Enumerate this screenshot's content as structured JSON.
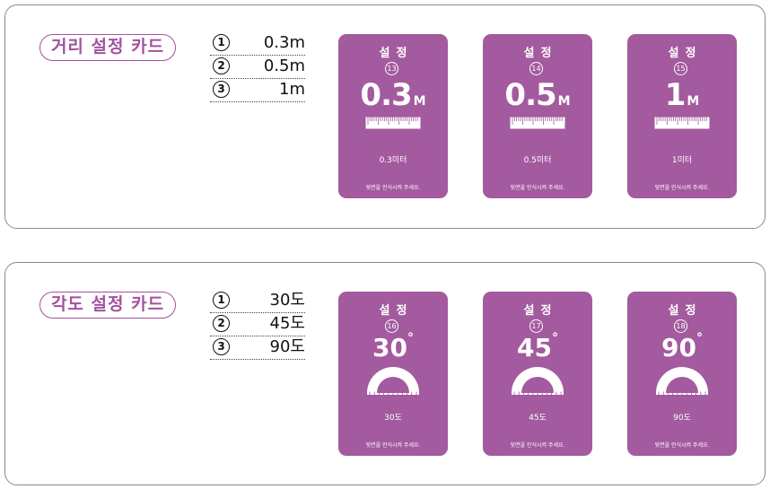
{
  "distance": {
    "title": "거리 설정 카드",
    "options": [
      {
        "num": "1",
        "value": "0.3m"
      },
      {
        "num": "2",
        "value": "0.5m"
      },
      {
        "num": "3",
        "value": "1m"
      }
    ],
    "cards": [
      {
        "title": "설정",
        "num": "13",
        "value": "0.3",
        "unit": "M",
        "label": "0.3미터",
        "hint": "뒷면을 인식시켜 주세요."
      },
      {
        "title": "설정",
        "num": "14",
        "value": "0.5",
        "unit": "M",
        "label": "0.5미터",
        "hint": "뒷면을 인식시켜 주세요."
      },
      {
        "title": "설정",
        "num": "15",
        "value": "1",
        "unit": "M",
        "label": "1미터",
        "hint": "뒷면을 인식시켜 주세요."
      }
    ]
  },
  "angle": {
    "title": "각도 설정 카드",
    "options": [
      {
        "num": "1",
        "value": "30도"
      },
      {
        "num": "2",
        "value": "45도"
      },
      {
        "num": "3",
        "value": "90도"
      }
    ],
    "cards": [
      {
        "title": "설정",
        "num": "16",
        "value": "30",
        "unit": "°",
        "label": "30도",
        "hint": "뒷면을 인식시켜 주세요."
      },
      {
        "title": "설정",
        "num": "17",
        "value": "45",
        "unit": "°",
        "label": "45도",
        "hint": "뒷면을 인식시켜 주세요."
      },
      {
        "title": "설정",
        "num": "18",
        "value": "90",
        "unit": "°",
        "label": "90도",
        "hint": "뒷면을 인식시켜 주세요."
      }
    ]
  },
  "colors": {
    "accent": "#a35a9e",
    "pill_border": "#a2519e"
  }
}
